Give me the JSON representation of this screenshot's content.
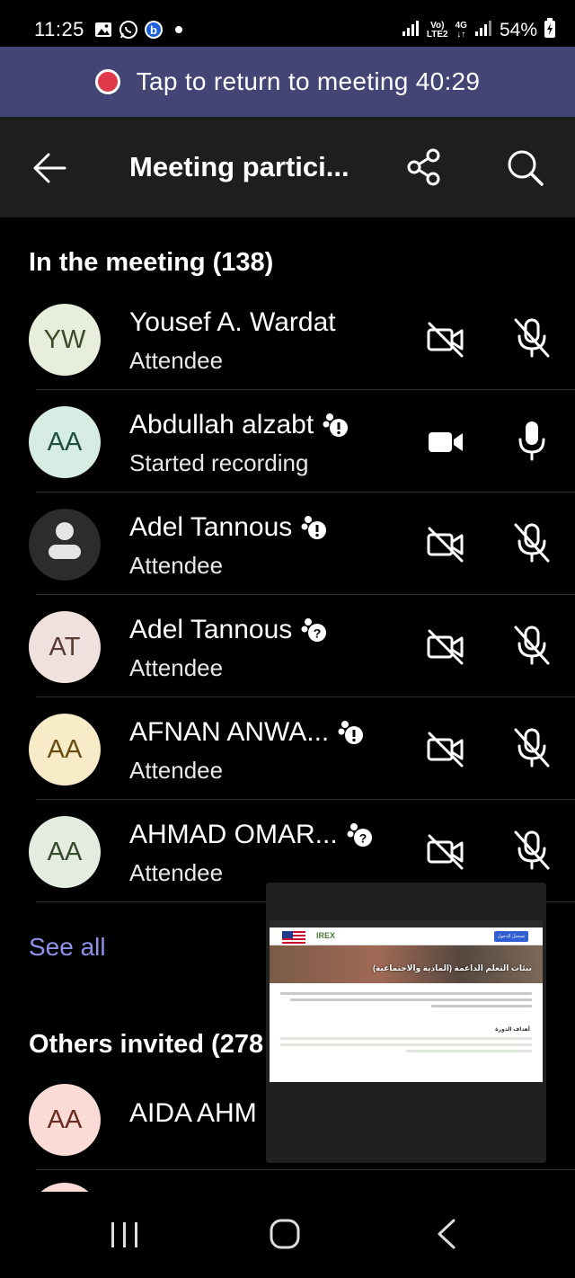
{
  "status_bar": {
    "time": "11:25",
    "network_top": "Vo)",
    "network_bottom": "LTE2",
    "network_type": "4G",
    "battery": "54%"
  },
  "banner": {
    "text": "Tap to return to meeting 40:29"
  },
  "header": {
    "title": "Meeting partici..."
  },
  "in_meeting": {
    "title": "In the meeting (138)",
    "participants": [
      {
        "initials": "YW",
        "name": "Yousef A. Wardat",
        "role": "Attendee",
        "avatar_bg": "#e8eedc",
        "avatar_fg": "#3c4a2a",
        "badge": "",
        "camera": "off",
        "mic": "off"
      },
      {
        "initials": "AA",
        "name": "Abdullah alzabt",
        "role": "Started recording",
        "avatar_bg": "#d7ece3",
        "avatar_fg": "#1f4f3c",
        "badge": "info",
        "camera": "on",
        "mic": "on"
      },
      {
        "initials": "",
        "name": "Adel Tannous",
        "role": "Attendee",
        "avatar_bg": "#2c2c2c",
        "avatar_fg": "#ffffff",
        "badge": "info",
        "camera": "off",
        "mic": "off"
      },
      {
        "initials": "AT",
        "name": "Adel Tannous",
        "role": "Attendee",
        "avatar_bg": "#efe1de",
        "avatar_fg": "#5a3b34",
        "badge": "question",
        "camera": "off",
        "mic": "off"
      },
      {
        "initials": "AA",
        "name": "AFNAN ANWA...",
        "role": "Attendee",
        "avatar_bg": "#f8ebc8",
        "avatar_fg": "#6a4b12",
        "badge": "info",
        "camera": "off",
        "mic": "off"
      },
      {
        "initials": "AA",
        "name": "AHMAD OMAR...",
        "role": "Attendee",
        "avatar_bg": "#e4ecdf",
        "avatar_fg": "#344a2c",
        "badge": "question",
        "camera": "off",
        "mic": "off"
      }
    ],
    "see_all": "See all"
  },
  "others_invited": {
    "title": "Others invited (278",
    "participants": [
      {
        "initials": "AA",
        "name": "AIDA AHM",
        "avatar_bg": "#fadbd6",
        "avatar_fg": "#6a2a22"
      }
    ]
  },
  "pip_preview": {
    "logo_text": "IREX",
    "button_text": "تسجيل الدخول",
    "hero_text": "بيئات التعلم الداعمة (المادية والاجتماعية)",
    "subheading": "أهداف الدورة"
  },
  "colors": {
    "banner_bg": "#434574",
    "link": "#8e92e8",
    "recording_dot": "#e03a4a"
  }
}
